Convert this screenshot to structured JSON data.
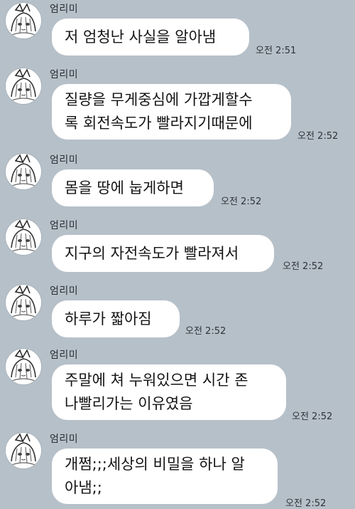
{
  "chat": {
    "messages": [
      {
        "sender": "엄리미",
        "lines": [
          "저 엄청난 사실을 알아냄"
        ],
        "time": "오전 2:51"
      },
      {
        "sender": "엄리미",
        "lines": [
          "질량을 무게중심에 가깝게할수",
          "록 회전속도가 빨라지기때문에"
        ],
        "time": "오전 2:52"
      },
      {
        "sender": "엄리미",
        "lines": [
          "몸을 땅에 눕게하면"
        ],
        "time": "오전 2:52"
      },
      {
        "sender": "엄리미",
        "lines": [
          "지구의 자전속도가 빨라져서"
        ],
        "time": "오전 2:52"
      },
      {
        "sender": "엄리미",
        "lines": [
          "하루가 짧아짐"
        ],
        "time": "오전 2:52"
      },
      {
        "sender": "엄리미",
        "lines": [
          "주말에 쳐 누워있으면 시간 존",
          "나빨리가는 이유였음"
        ],
        "time": "오전 2:52"
      },
      {
        "sender": "엄리미",
        "lines": [
          "개쩜;;;세상의 비밀을 하나 알",
          "아냄;;"
        ],
        "time": "오전 2:52"
      }
    ]
  },
  "colors": {
    "background": "#b6c0c9",
    "bubble": "#ffffff",
    "text": "#141414"
  }
}
